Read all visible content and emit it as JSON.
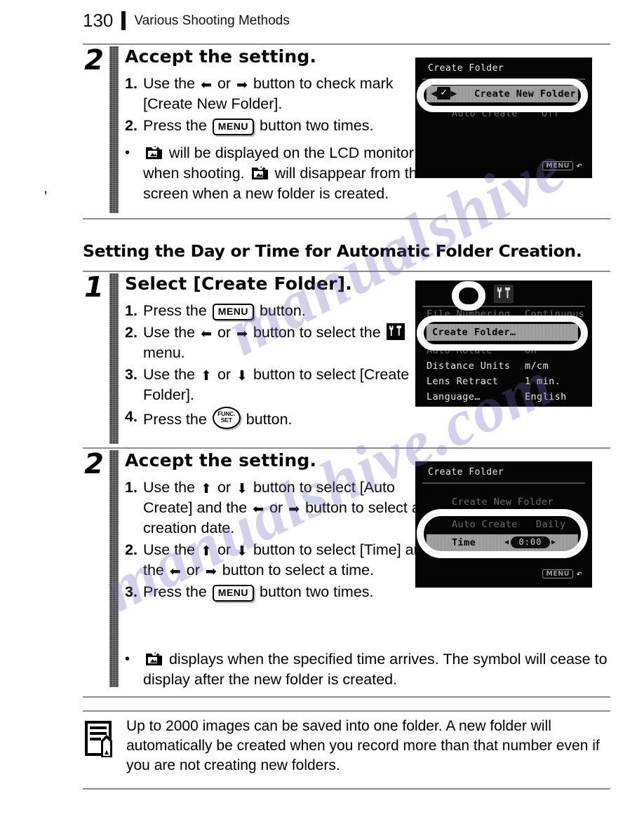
{
  "header": {
    "page_number": "130",
    "title": "Various Shooting Methods"
  },
  "step_top": {
    "number": "2",
    "title": "Accept the setting.",
    "substeps": [
      {
        "marker": "1.",
        "parts": [
          {
            "t": "text",
            "v": "Use the "
          },
          {
            "t": "icon",
            "v": "arrow-left-icon"
          },
          {
            "t": "text",
            "v": " or "
          },
          {
            "t": "icon",
            "v": "arrow-right-icon"
          },
          {
            "t": "text",
            "v": " button to check mark [Create New Folder]."
          }
        ]
      },
      {
        "marker": "2.",
        "parts": [
          {
            "t": "text",
            "v": "Press the "
          },
          {
            "t": "icon",
            "v": "menu-button-icon"
          },
          {
            "t": "text",
            "v": " button two times."
          }
        ]
      }
    ],
    "bullet": {
      "marker": "•",
      "parts": [
        {
          "t": "icon",
          "v": "new-folder-icon"
        },
        {
          "t": "text",
          "v": " will be displayed on the LCD monitor when shooting. "
        },
        {
          "t": "icon",
          "v": "new-folder-icon"
        },
        {
          "t": "text",
          "v": " will disappear from the screen when a new folder is created."
        }
      ]
    }
  },
  "section_heading": "Setting the Day or Time for Automatic Folder Creation.",
  "step_one": {
    "number": "1",
    "title": "Select [Create Folder].",
    "substeps": [
      {
        "marker": "1.",
        "parts": [
          {
            "t": "text",
            "v": "Press the "
          },
          {
            "t": "icon",
            "v": "menu-button-icon"
          },
          {
            "t": "text",
            "v": " button."
          }
        ]
      },
      {
        "marker": "2.",
        "parts": [
          {
            "t": "text",
            "v": "Use the "
          },
          {
            "t": "icon",
            "v": "arrow-left-icon"
          },
          {
            "t": "text",
            "v": " or "
          },
          {
            "t": "icon",
            "v": "arrow-right-icon"
          },
          {
            "t": "text",
            "v": " button to select the "
          },
          {
            "t": "icon",
            "v": "tools-menu-icon"
          },
          {
            "t": "text",
            "v": " menu."
          }
        ]
      },
      {
        "marker": "3.",
        "parts": [
          {
            "t": "text",
            "v": "Use the "
          },
          {
            "t": "icon",
            "v": "arrow-up-icon"
          },
          {
            "t": "text",
            "v": " or "
          },
          {
            "t": "icon",
            "v": "arrow-down-icon"
          },
          {
            "t": "text",
            "v": " button to select [Create Folder]."
          }
        ]
      },
      {
        "marker": "4.",
        "parts": [
          {
            "t": "text",
            "v": "Press the "
          },
          {
            "t": "icon",
            "v": "func-set-button-icon"
          },
          {
            "t": "text",
            "v": " button."
          }
        ]
      }
    ]
  },
  "step_two": {
    "number": "2",
    "title": "Accept the setting.",
    "substeps": [
      {
        "marker": "1.",
        "parts": [
          {
            "t": "text",
            "v": "Use the "
          },
          {
            "t": "icon",
            "v": "arrow-up-icon"
          },
          {
            "t": "text",
            "v": " or "
          },
          {
            "t": "icon",
            "v": "arrow-down-icon"
          },
          {
            "t": "text",
            "v": " button to select [Auto Create] and the "
          },
          {
            "t": "icon",
            "v": "arrow-left-icon"
          },
          {
            "t": "text",
            "v": " or "
          },
          {
            "t": "icon",
            "v": "arrow-right-icon"
          },
          {
            "t": "text",
            "v": " button to select a creation date."
          }
        ]
      },
      {
        "marker": "2.",
        "parts": [
          {
            "t": "text",
            "v": "Use the "
          },
          {
            "t": "icon",
            "v": "arrow-up-icon"
          },
          {
            "t": "text",
            "v": " or "
          },
          {
            "t": "icon",
            "v": "arrow-down-icon"
          },
          {
            "t": "text",
            "v": " button to select [Time] and the "
          },
          {
            "t": "icon",
            "v": "arrow-left-icon"
          },
          {
            "t": "text",
            "v": " or "
          },
          {
            "t": "icon",
            "v": "arrow-right-icon"
          },
          {
            "t": "text",
            "v": " button to select a time."
          }
        ]
      },
      {
        "marker": "3.",
        "parts": [
          {
            "t": "text",
            "v": "Press the "
          },
          {
            "t": "icon",
            "v": "menu-button-icon"
          },
          {
            "t": "text",
            "v": " button two times."
          }
        ]
      }
    ],
    "bullet": {
      "marker": "•",
      "parts": [
        {
          "t": "icon",
          "v": "new-folder-icon"
        },
        {
          "t": "text",
          "v": " displays when the specified time arrives. The symbol will cease to display after the new folder is created."
        }
      ]
    }
  },
  "lcd_top": {
    "title": "Create Folder",
    "highlight_row": {
      "check": "✓",
      "label": "Create New Folder"
    },
    "rows": [
      {
        "label": "Auto Create",
        "value": "Off"
      }
    ],
    "return_chip": "MENU",
    "return_arrow": "↶"
  },
  "lcd_menu": {
    "tab_icon": "tools-menu-icon",
    "rows_above": [
      {
        "label": "File Numbering",
        "value": "Continuous"
      }
    ],
    "highlight_row": {
      "label": "Create Folder…",
      "value": ""
    },
    "rows_below": [
      {
        "label": "Auto Rotate",
        "value": "On"
      },
      {
        "label": "Distance Units",
        "value": "m/cm"
      },
      {
        "label": "Lens Retract",
        "value": "1 min."
      },
      {
        "label": "Language…",
        "value": "English"
      }
    ]
  },
  "lcd_bottom": {
    "title": "Create Folder",
    "rows": [
      {
        "label": "Create New Folder",
        "value": ""
      },
      {
        "label": "Auto Create",
        "value": "Daily"
      }
    ],
    "highlight_row": {
      "label": "Time",
      "value": "0:00"
    },
    "return_chip": "MENU",
    "return_arrow": "↶"
  },
  "note": {
    "icon": "note-pencil-icon",
    "text": "Up to 2000 images can be saved into one folder. A new folder will automatically be created when you record more than that number even if you are not creating new folders."
  },
  "watermark": {
    "line_a": "manualshive",
    "line_b": "manualshive.com"
  },
  "colors": {
    "ink": "#000000",
    "rule": "#8d8d8d",
    "step_bar": "#4a4a4a",
    "lcd_bg": "#050505",
    "lcd_text": "#e8e8e8",
    "lcd_highlight": "#9a9a9a",
    "watermark": "#6b6bb8"
  }
}
